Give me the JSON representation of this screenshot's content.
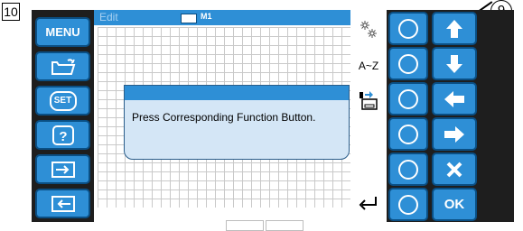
{
  "step_number": "10",
  "callout_number": "9",
  "left_buttons": [
    {
      "label": "MENU",
      "icon": "menu-text"
    },
    {
      "label": "",
      "icon": "open-folder-icon"
    },
    {
      "label": "SET",
      "icon": "set-icon"
    },
    {
      "label": "",
      "icon": "help-icon"
    },
    {
      "label": "",
      "icon": "load-arrow-icon"
    },
    {
      "label": "",
      "icon": "save-arrow-icon"
    }
  ],
  "editor": {
    "title": "Edit",
    "memory_label": "M1"
  },
  "popup": {
    "message": "Press Corresponding Function Button."
  },
  "side_panel": {
    "item_1_icon": "flower-stamp-icon",
    "item_2_label": "A~Z",
    "item_3_icon": "transfer-icon",
    "return_icon": "return-arrow-icon"
  },
  "arrow_buttons": [
    {
      "icon": "arrow-up-icon"
    },
    {
      "icon": "arrow-down-icon"
    },
    {
      "icon": "arrow-left-icon"
    },
    {
      "icon": "arrow-right-icon"
    },
    {
      "icon": "close-x-icon"
    },
    {
      "label": "OK"
    }
  ],
  "colors": {
    "button_blue": "#2e8fd6",
    "button_border": "#0a4f84",
    "popup_bg": "#d4e6f6",
    "screen_bg": "#1e1e1e"
  }
}
